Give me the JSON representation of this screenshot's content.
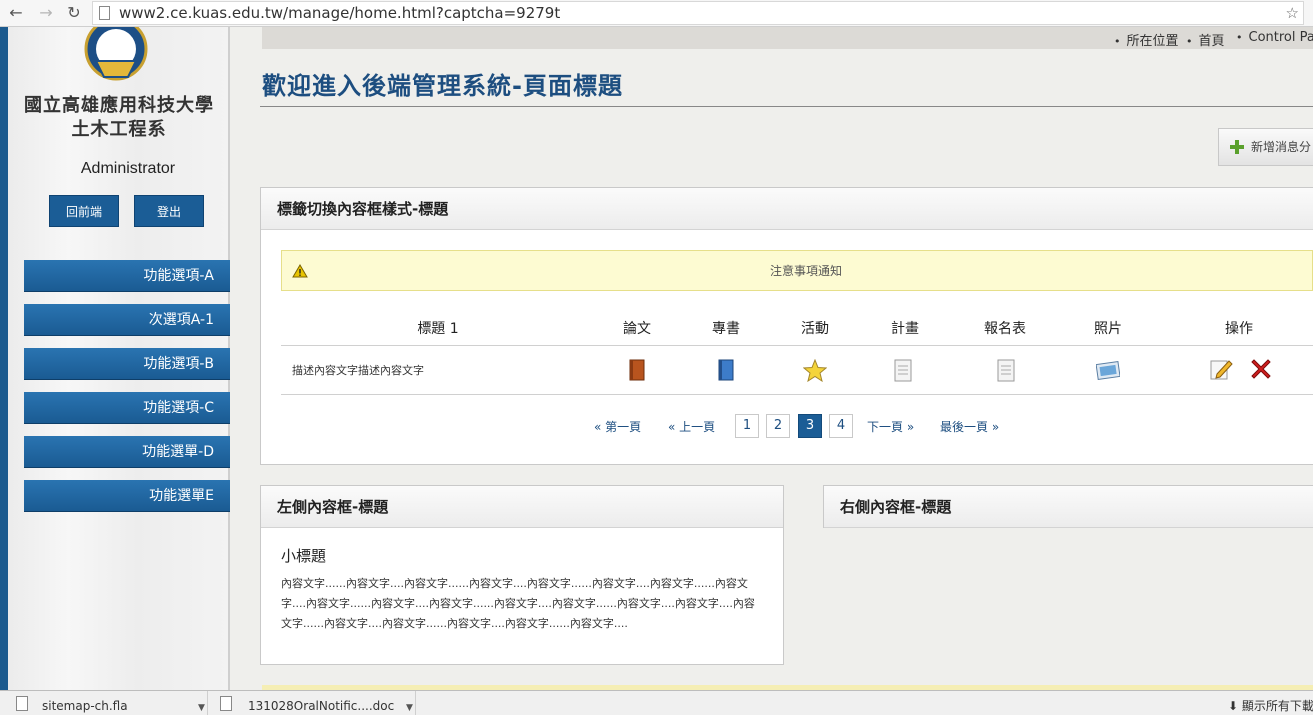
{
  "browser": {
    "url": "www2.ce.kuas.edu.tw/manage/home.html?captcha=9279t"
  },
  "sidebar": {
    "dept_line1": "國立高雄應用科技大學",
    "dept_line2": "土木工程系",
    "user": "Administrator",
    "btn_frontend": "回前端",
    "btn_logout": "登出",
    "menu": [
      "功能選項-A",
      "次選項A-1",
      "功能選項-B",
      "功能選項-C",
      "功能選單-D",
      "功能選單E"
    ]
  },
  "breadcrumb": {
    "location": "所在位置",
    "home": "首頁",
    "panel": "Control Pa"
  },
  "page_title": "歡迎進入後端管理系統-頁面標題",
  "add_button": "新增消息分",
  "tab_panel": {
    "title": "標籤切換內容框樣式-標題",
    "notice": "注意事項通知",
    "headers": [
      "標題 1",
      "論文",
      "專書",
      "活動",
      "計畫",
      "報名表",
      "照片",
      "操作"
    ],
    "row_text": "描述內容文字描述內容文字",
    "pager": {
      "first": "« 第一頁",
      "prev": "« 上一頁",
      "pages": [
        "1",
        "2",
        "3",
        "4"
      ],
      "current": "3",
      "next": "下一頁 »",
      "last": "最後一頁 »"
    }
  },
  "left_panel": {
    "title": "左側內容框-標題",
    "subtitle": "小標題",
    "body": "內容文字......內容文字....內容文字......內容文字....內容文字......內容文字....內容文字......內容文字....內容文字......內容文字....內容文字......內容文字....內容文字......內容文字....內容文字....內容文字......內容文字....內容文字......內容文字....內容文字......內容文字...."
  },
  "right_panel": {
    "title": "右側內容框-標題"
  },
  "downloads": {
    "file1": "sitemap-ch.fla",
    "file2": "131028OralNotific....doc",
    "show_all": "顯示所有下載"
  },
  "colors": {
    "brand_blue": "#1b5d96",
    "title_blue": "#1d4e80",
    "notice_bg": "#fdfbd2"
  }
}
